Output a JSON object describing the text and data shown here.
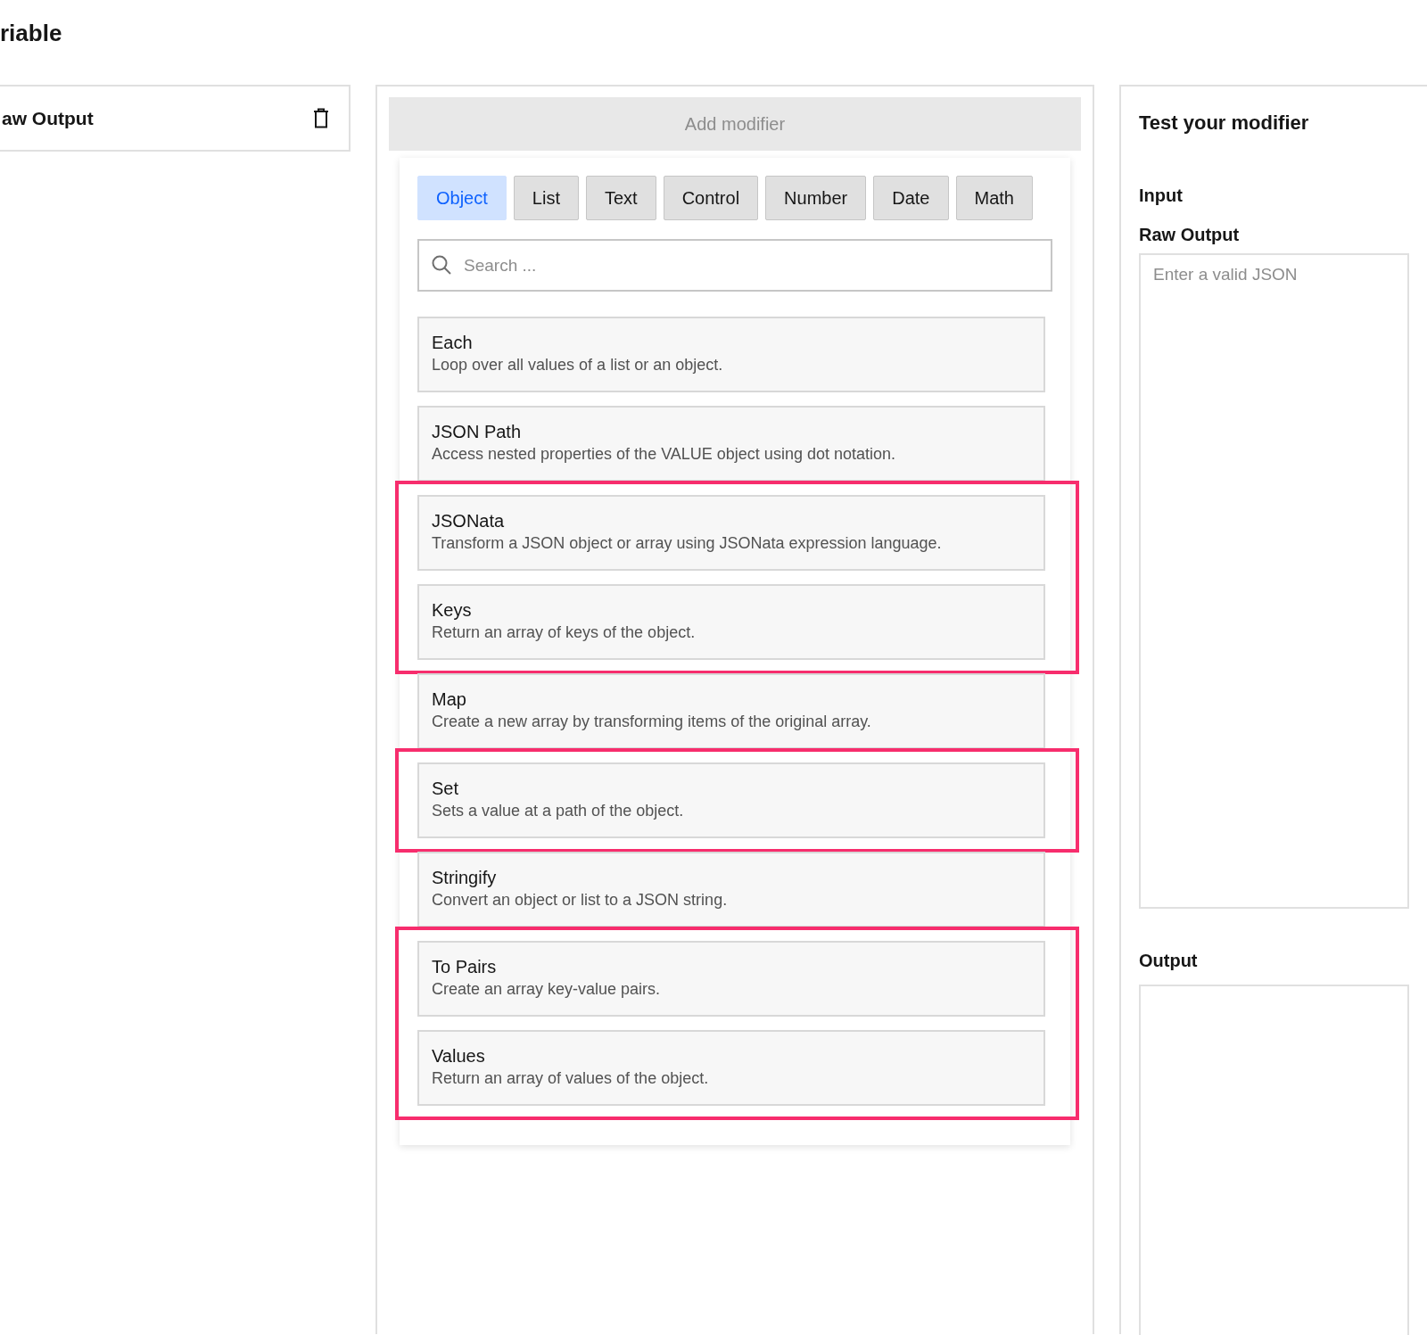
{
  "page": {
    "title": "riable"
  },
  "variable_card": {
    "title": "aw Output"
  },
  "modifier_panel": {
    "add_button": "Add modifier",
    "tabs": [
      {
        "label": "Object",
        "selected": true
      },
      {
        "label": "List",
        "selected": false
      },
      {
        "label": "Text",
        "selected": false
      },
      {
        "label": "Control",
        "selected": false
      },
      {
        "label": "Number",
        "selected": false
      },
      {
        "label": "Date",
        "selected": false
      },
      {
        "label": "Math",
        "selected": false
      }
    ],
    "search": {
      "placeholder": "Search ..."
    },
    "modifiers": [
      {
        "name": "Each",
        "description": "Loop over all values of a list or an object.",
        "highlighted": false
      },
      {
        "name": "JSON Path",
        "description": "Access nested properties of the VALUE object using dot notation.",
        "highlighted": false
      },
      {
        "name": "JSONata",
        "description": "Transform a JSON object or array using JSONata expression language.",
        "highlighted": true
      },
      {
        "name": "Keys",
        "description": "Return an array of keys of the object.",
        "highlighted": true
      },
      {
        "name": "Map",
        "description": "Create a new array by transforming items of the original array.",
        "highlighted": false
      },
      {
        "name": "Set",
        "description": "Sets a value at a path of the object.",
        "highlighted": true
      },
      {
        "name": "Stringify",
        "description": "Convert an object or list to a JSON string.",
        "highlighted": false
      },
      {
        "name": "To Pairs",
        "description": "Create an array key-value pairs.",
        "highlighted": true
      },
      {
        "name": "Values",
        "description": "Return an array of values of the object.",
        "highlighted": true
      }
    ]
  },
  "test_panel": {
    "title": "Test your modifier",
    "input_label": "Input",
    "raw_output_label": "Raw Output",
    "input_placeholder": "Enter a valid JSON",
    "output_label": "Output"
  }
}
